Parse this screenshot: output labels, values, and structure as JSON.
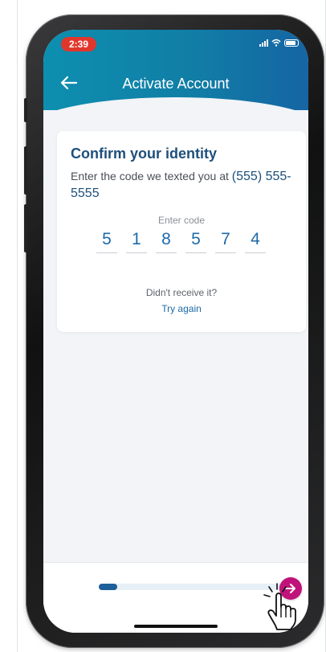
{
  "status_bar": {
    "time": "2:39"
  },
  "header": {
    "title": "Activate Account"
  },
  "card": {
    "title": "Confirm your identity",
    "subtitle": "Enter the code we texted you at",
    "phone": "(555) 555-5555",
    "code_label": "Enter code",
    "code_digits": [
      "5",
      "1",
      "8",
      "5",
      "7",
      "4"
    ],
    "resend_question": "Didn't receive it?",
    "resend_link": "Try again"
  },
  "progress": {
    "fraction": 0.1
  },
  "colors": {
    "header_start": "#0d8fb0",
    "header_end": "#1565a3",
    "accent_blue": "#1e6aa8",
    "title_blue": "#1e4f7a",
    "next_button": "#c0137a",
    "status_time_bg": "#e0362c"
  },
  "icons": {
    "back": "back-arrow-icon",
    "next": "arrow-right-icon",
    "cursor": "hand-pointer-icon"
  }
}
